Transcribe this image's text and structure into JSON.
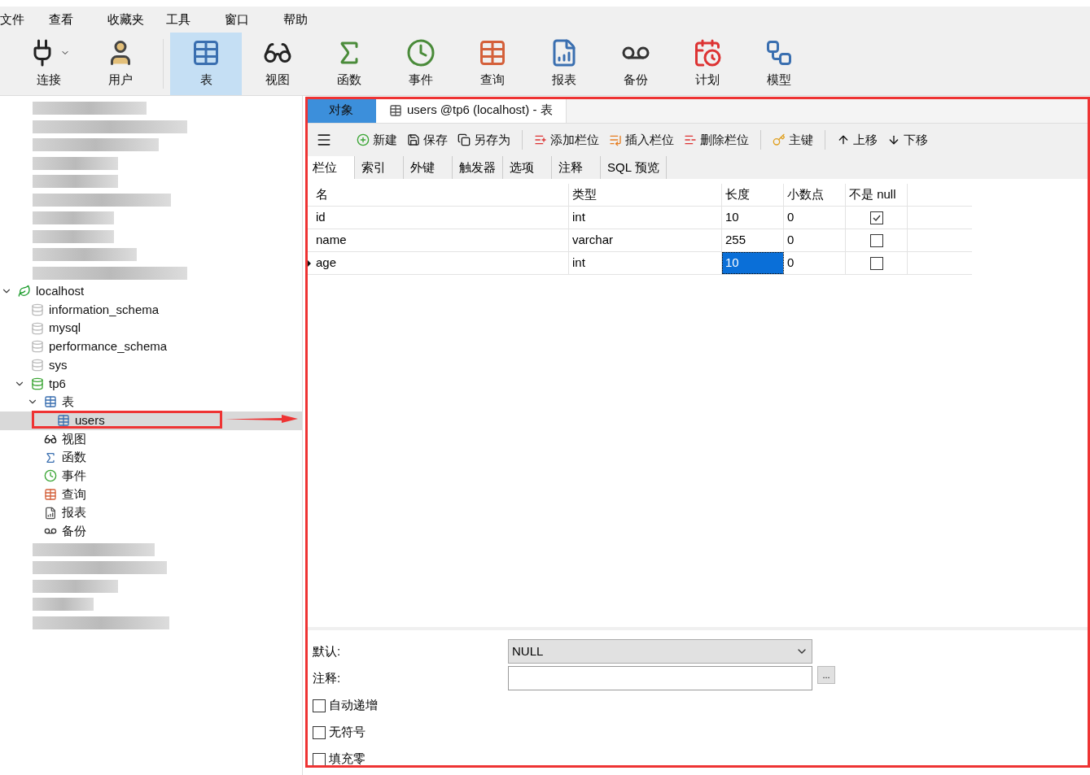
{
  "menu": [
    "文件",
    "查看",
    "收藏夹",
    "工具",
    "窗口",
    "帮助"
  ],
  "toolbar": [
    {
      "kind": "connect",
      "label": "连接",
      "selected": false
    },
    {
      "kind": "user",
      "label": "用户",
      "selected": false
    },
    {
      "kind": "table",
      "label": "表",
      "selected": true
    },
    {
      "kind": "view",
      "label": "视图",
      "selected": false
    },
    {
      "kind": "function",
      "label": "函数",
      "selected": false
    },
    {
      "kind": "event",
      "label": "事件",
      "selected": false
    },
    {
      "kind": "query",
      "label": "查询",
      "selected": false
    },
    {
      "kind": "report",
      "label": "报表",
      "selected": false
    },
    {
      "kind": "backup",
      "label": "备份",
      "selected": false
    },
    {
      "kind": "schedule",
      "label": "计划",
      "selected": false
    },
    {
      "kind": "model",
      "label": "模型",
      "selected": false
    }
  ],
  "tree": [
    {
      "kind": "server",
      "label": "localhost",
      "expanded": true,
      "selected": false,
      "children": [
        {
          "kind": "db",
          "label": "information_schema",
          "active": false,
          "selected": false
        },
        {
          "kind": "db",
          "label": "mysql",
          "active": false,
          "selected": false
        },
        {
          "kind": "db",
          "label": "performance_schema",
          "active": false,
          "selected": false
        },
        {
          "kind": "db",
          "label": "sys",
          "active": false,
          "selected": false
        },
        {
          "kind": "db",
          "label": "tp6",
          "active": true,
          "expanded": true,
          "selected": false,
          "children": [
            {
              "kind": "table",
              "label": "表",
              "expanded": true,
              "selected": false,
              "children": [
                {
                  "kind": "table",
                  "label": "users",
                  "selected": true
                }
              ]
            },
            {
              "kind": "view",
              "label": "视图",
              "selected": false
            },
            {
              "kind": "function",
              "label": "函数",
              "selected": false
            },
            {
              "kind": "event",
              "label": "事件",
              "selected": false
            },
            {
              "kind": "query",
              "label": "查询",
              "selected": false
            },
            {
              "kind": "report",
              "label": "报表",
              "selected": false
            },
            {
              "kind": "backup",
              "label": "备份",
              "selected": false
            }
          ]
        }
      ]
    }
  ],
  "doc_tabs": [
    {
      "label": "对象",
      "selected": true
    },
    {
      "label": "users @tp6 (localhost) - 表",
      "selected": false
    }
  ],
  "actions": [
    {
      "kind": "new",
      "label": "新建"
    },
    {
      "kind": "save",
      "label": "保存"
    },
    {
      "kind": "saveas",
      "label": "另存为"
    },
    {
      "kind": "add",
      "label": "添加栏位"
    },
    {
      "kind": "insert",
      "label": "插入栏位"
    },
    {
      "kind": "delete",
      "label": "删除栏位"
    },
    {
      "kind": "key",
      "label": "主键"
    },
    {
      "kind": "up",
      "label": "上移"
    },
    {
      "kind": "down",
      "label": "下移"
    }
  ],
  "sub_tabs": [
    {
      "label": "栏位",
      "selected": true
    },
    {
      "label": "索引",
      "selected": false
    },
    {
      "label": "外键",
      "selected": false
    },
    {
      "label": "触发器",
      "selected": false
    },
    {
      "label": "选项",
      "selected": false
    },
    {
      "label": "注释",
      "selected": false
    },
    {
      "label": "SQL 预览",
      "selected": false
    }
  ],
  "table": {
    "columns": [
      "名",
      "类型",
      "长度",
      "小数点",
      "不是 null"
    ],
    "rows": [
      {
        "name": "id",
        "type": "int",
        "length": "10",
        "decimals": "0",
        "not_null": true,
        "current": false,
        "length_selected": false
      },
      {
        "name": "name",
        "type": "varchar",
        "length": "255",
        "decimals": "0",
        "not_null": false,
        "current": false,
        "length_selected": false
      },
      {
        "name": "age",
        "type": "int",
        "length": "10",
        "decimals": "0",
        "not_null": false,
        "current": true,
        "length_selected": true
      }
    ]
  },
  "properties": {
    "default_label": "默认:",
    "default_value": "NULL",
    "comment_label": "注释:",
    "more_button": "...",
    "options": [
      {
        "label": "自动递增",
        "checked": false
      },
      {
        "label": "无符号",
        "checked": false
      },
      {
        "label": "填充零",
        "checked": false
      }
    ]
  }
}
